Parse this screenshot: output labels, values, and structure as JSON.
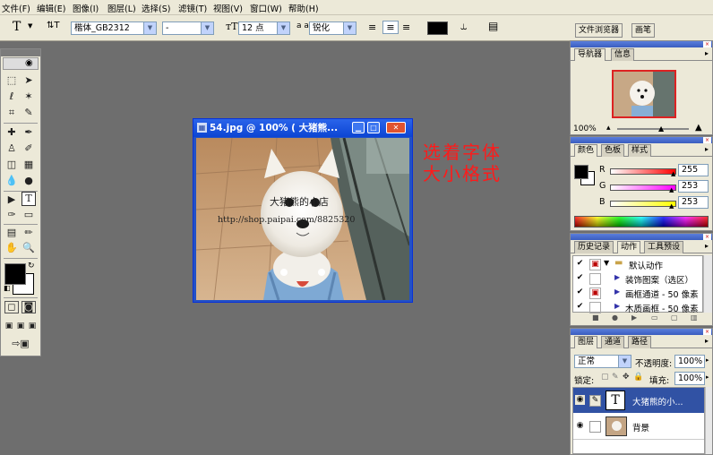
{
  "menu": [
    "文件(F)",
    "编辑(E)",
    "图像(I)",
    "图层(L)",
    "选择(S)",
    "滤镜(T)",
    "视图(V)",
    "窗口(W)",
    "帮助(H)"
  ],
  "options": {
    "tool_glyph": "T",
    "orient_glyph": "⇅T",
    "font_family": "楷体_GB2312",
    "font_style": "-",
    "size_glyph": "тT",
    "font_size": "12 点",
    "aa_glyph": "a a",
    "antialias": "锐化"
  },
  "well_tabs": [
    "文件浏览器",
    "画笔"
  ],
  "document": {
    "title": "54.jpg @ 100% ( 大猪熊...",
    "watermark_title": "大猪熊的小店",
    "watermark_url": "http://shop.paipai.com/8825320"
  },
  "annotation": {
    "line1": "选着字体",
    "line2": "大小格式"
  },
  "navigator": {
    "tabs": [
      "导航器",
      "信息"
    ],
    "zoom": "100%"
  },
  "color": {
    "tabs": [
      "颜色",
      "色板",
      "样式"
    ],
    "channels": [
      {
        "label": "R",
        "value": "255",
        "color": "#ff0000"
      },
      {
        "label": "G",
        "value": "253",
        "color": "#ff00ff"
      },
      {
        "label": "B",
        "value": "253",
        "color": "#ffff00"
      }
    ]
  },
  "history": {
    "tabs": [
      "历史记录",
      "动作",
      "工具预设"
    ],
    "items": [
      "默认动作",
      "装饰图案（选区）",
      "画框通道 - 50 像素",
      "木质画框 - 50 像素"
    ]
  },
  "layers": {
    "tabs": [
      "图层",
      "通道",
      "路径"
    ],
    "blend_mode": "正常",
    "opacity_label": "不透明度:",
    "opacity": "100%",
    "lock_label": "锁定:",
    "fill_label": "填充:",
    "fill": "100%",
    "items": [
      {
        "name": "大猪熊的小...",
        "type": "text"
      },
      {
        "name": "背景",
        "type": "image"
      }
    ]
  }
}
